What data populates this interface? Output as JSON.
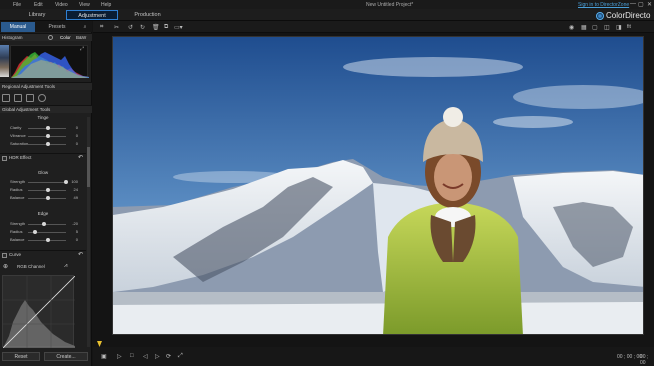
{
  "menu": {
    "items": [
      "File",
      "Edit",
      "Video",
      "View",
      "Help"
    ]
  },
  "window": {
    "title": "New Untitled Project*",
    "signin": "Sign in to DirectorZone",
    "min": "—",
    "max": "▢",
    "close": "✕"
  },
  "modes": {
    "library": "Library",
    "adjustment": "Adjustment",
    "production": "Production"
  },
  "brand": {
    "name": "ColorDirecto"
  },
  "left_tabs": {
    "manual": "Manual",
    "presets": "Presets"
  },
  "histogram": {
    "title": "Histogram",
    "color": "Color",
    "bw": "B&W"
  },
  "regional": {
    "title": "Regional Adjustment Tools"
  },
  "global": {
    "title": "Global Adjustment Tools"
  },
  "tinge": {
    "title": "Tinge",
    "rows": [
      {
        "label": "Clarity",
        "value": "0",
        "level": 0.5
      },
      {
        "label": "Vibrance",
        "value": "0",
        "level": 0.5
      },
      {
        "label": "Saturation",
        "value": "0",
        "level": 0.5
      }
    ]
  },
  "hdr": {
    "title": "HDR Effect",
    "glow_title": "Glow",
    "glow": [
      {
        "label": "Strength",
        "value": "100",
        "level": 1.0
      },
      {
        "label": "Radius",
        "value": "24",
        "level": 0.5
      },
      {
        "label": "Balance",
        "value": "49",
        "level": 0.5
      }
    ],
    "edge_title": "Edge",
    "edge": [
      {
        "label": "Strength",
        "value": "-20",
        "level": 0.4
      },
      {
        "label": "Radius",
        "value": "5",
        "level": 0.15
      },
      {
        "label": "Balance",
        "value": "0",
        "level": 0.5
      }
    ]
  },
  "curve": {
    "title": "Curve",
    "channel": "RGB Channel"
  },
  "buttons": {
    "reset": "Reset",
    "create": "Create..."
  },
  "timecode": {
    "current": "00 ; 00 ; 00",
    "end": "00 ; 00"
  },
  "colors": {
    "accent": "#2f7fd1",
    "panel": "#1f1f1f",
    "active_tab": "#2a5a8e"
  }
}
